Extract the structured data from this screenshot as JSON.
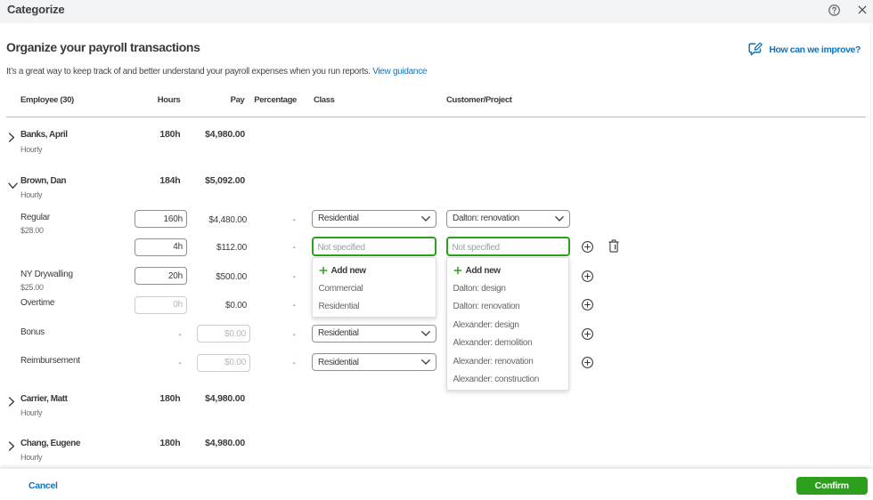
{
  "topbar": {
    "title": "Categorize"
  },
  "intro": {
    "heading": "Organize your payroll transactions",
    "subtitle": "It’s a great way to keep track of and better understand your payroll expenses when you run reports.",
    "guidance_link": "View guidance",
    "improve_link": "How can we improve?"
  },
  "table": {
    "columns": {
      "employee": "Employee (30)",
      "hours": "Hours",
      "pay": "Pay",
      "percentage": "Percentage",
      "class": "Class",
      "customer": "Customer/Project"
    },
    "employees": [
      {
        "name": "Banks, April",
        "type": "Hourly",
        "hours": "180h",
        "pay": "$4,980.00"
      },
      {
        "name": "Brown, Dan",
        "type": "Hourly",
        "hours": "184h",
        "pay": "$5,092.00"
      },
      {
        "name": "Carrier, Matt",
        "type": "Hourly",
        "hours": "180h",
        "pay": "$4,980.00"
      },
      {
        "name": "Chang, Eugene",
        "type": "Hourly",
        "hours": "180h",
        "pay": "$4,980.00"
      }
    ],
    "brown_items": [
      {
        "label": "Regular",
        "rate": "$28.00",
        "hours_value": "160h",
        "pay": "$4,480.00",
        "pct": "-",
        "class_value": "Residential",
        "customer_value": "Dalton: renovation"
      },
      {
        "hours_value": "4h",
        "pay": "$112.00",
        "pct": "-",
        "class_placeholder": "Not specified",
        "customer_placeholder": "Not specified"
      },
      {
        "label": "NY Drywalling",
        "rate": "$25.00",
        "hours_value": "20h",
        "pay": "$500.00",
        "pct": "-"
      },
      {
        "label": "Overtime",
        "hours_placeholder": "0h",
        "pay": "$0.00",
        "pct": "-"
      },
      {
        "label": "Bonus",
        "hours_dash": "-",
        "pay_placeholder": "$0.00",
        "pct": "-",
        "class_value": "Residential"
      },
      {
        "label": "Reimbursement",
        "hours_dash": "-",
        "pay_placeholder": "$0.00",
        "pct": "-",
        "class_value": "Residential"
      }
    ],
    "class_popup": {
      "add_new": "Add new",
      "options": [
        "Commercial",
        "Residential"
      ]
    },
    "customer_popup": {
      "add_new": "Add new",
      "options": [
        "Dalton: design",
        "Dalton: renovation",
        "Alexander: design",
        "Alexander: demolition",
        "Alexander: renovation",
        "Alexander: construction"
      ]
    }
  },
  "footer": {
    "cancel": "Cancel",
    "confirm": "Confirm"
  },
  "colors": {
    "green": "#2ca01c",
    "blue": "#1173ba",
    "text": "#393a3d",
    "muted": "#6b6c72"
  }
}
